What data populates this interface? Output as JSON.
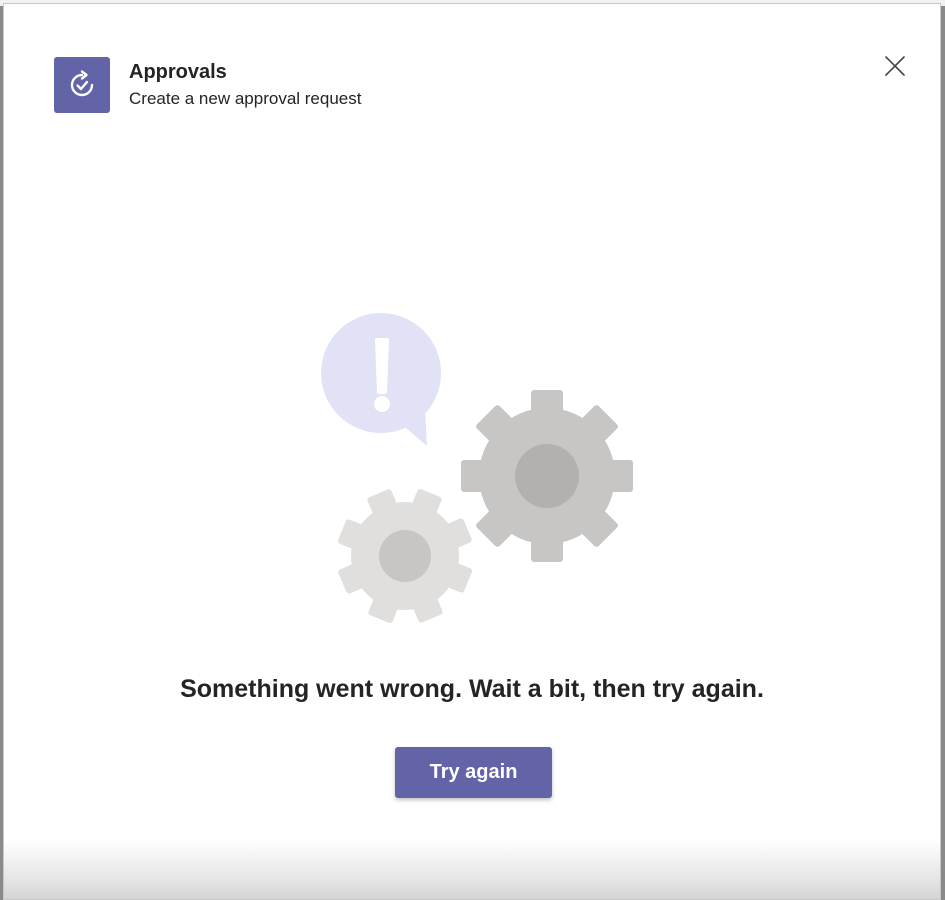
{
  "dialog": {
    "app_icon": "approvals-icon",
    "title": "Approvals",
    "subtitle": "Create a new approval request",
    "close_icon": "close-icon"
  },
  "error": {
    "illustration": "gears-error-illustration",
    "message": "Something went wrong. Wait a bit, then try again.",
    "retry_label": "Try again"
  },
  "colors": {
    "brand": "#6264a7",
    "bubble": "#e2e2f6",
    "gear_large": "#c8c6c4",
    "gear_large_hub": "#b3b0ad",
    "gear_small": "#e1dfdd",
    "gear_small_hub": "#c8c6c4",
    "text": "#252423"
  }
}
